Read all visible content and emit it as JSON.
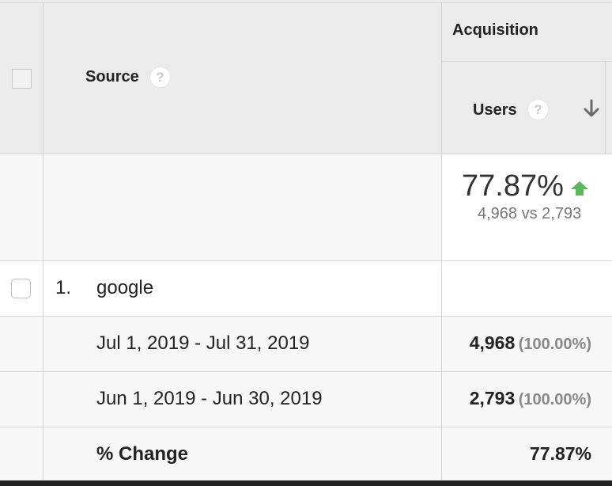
{
  "header": {
    "source_label": "Source",
    "source_help": "?",
    "group_label": "Acquisition",
    "users_label": "Users",
    "users_help": "?"
  },
  "summary": {
    "change_pct": "77.87%",
    "comparison": "4,968 vs 2,793",
    "trend": "up",
    "trend_color": "#5cb85c"
  },
  "rows": [
    {
      "index": "1.",
      "source": "google"
    }
  ],
  "detail_rows": [
    {
      "period": "Jul 1, 2019 - Jul 31, 2019",
      "users": "4,968",
      "users_pct": "(100.00%)"
    },
    {
      "period": "Jun 1, 2019 - Jun 30, 2019",
      "users": "2,793",
      "users_pct": "(100.00%)"
    }
  ],
  "change_row": {
    "label": "% Change",
    "value": "77.87%"
  },
  "icons": {
    "sort": "arrow-down-icon",
    "trend": "triangle-up-arrow-icon",
    "help": "question-icon"
  }
}
